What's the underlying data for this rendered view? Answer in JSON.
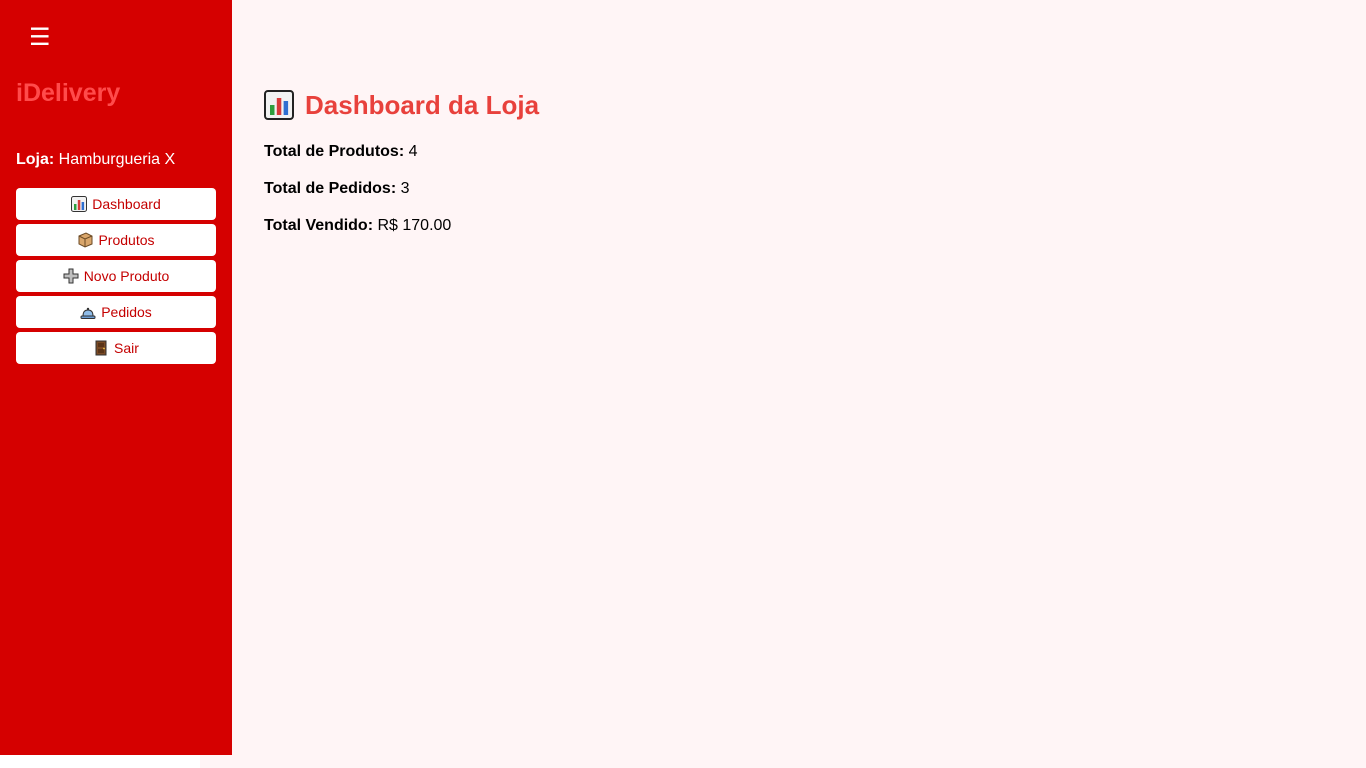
{
  "sidebar": {
    "menu_icon": "hamburger-icon",
    "brand": "iDelivery",
    "store_label": "Loja:",
    "store_name": "Hamburgueria X",
    "items": [
      {
        "icon": "bar-chart-icon",
        "label": "Dashboard"
      },
      {
        "icon": "box-icon",
        "label": "Produtos"
      },
      {
        "icon": "plus-icon",
        "label": "Novo Produto"
      },
      {
        "icon": "tray-icon",
        "label": "Pedidos"
      },
      {
        "icon": "door-icon",
        "label": "Sair"
      }
    ]
  },
  "main": {
    "title_icon": "bar-chart-icon",
    "title": "Dashboard da Loja",
    "stats": [
      {
        "label": "Total de Produtos:",
        "value": "4"
      },
      {
        "label": "Total de Pedidos:",
        "value": "3"
      },
      {
        "label": "Total Vendido:",
        "value": "R$ 170.00"
      }
    ]
  },
  "colors": {
    "sidebar_bg": "#d50000",
    "brand": "#ff4b4b",
    "title": "#e8413c",
    "page_bg": "#fff5f6"
  }
}
